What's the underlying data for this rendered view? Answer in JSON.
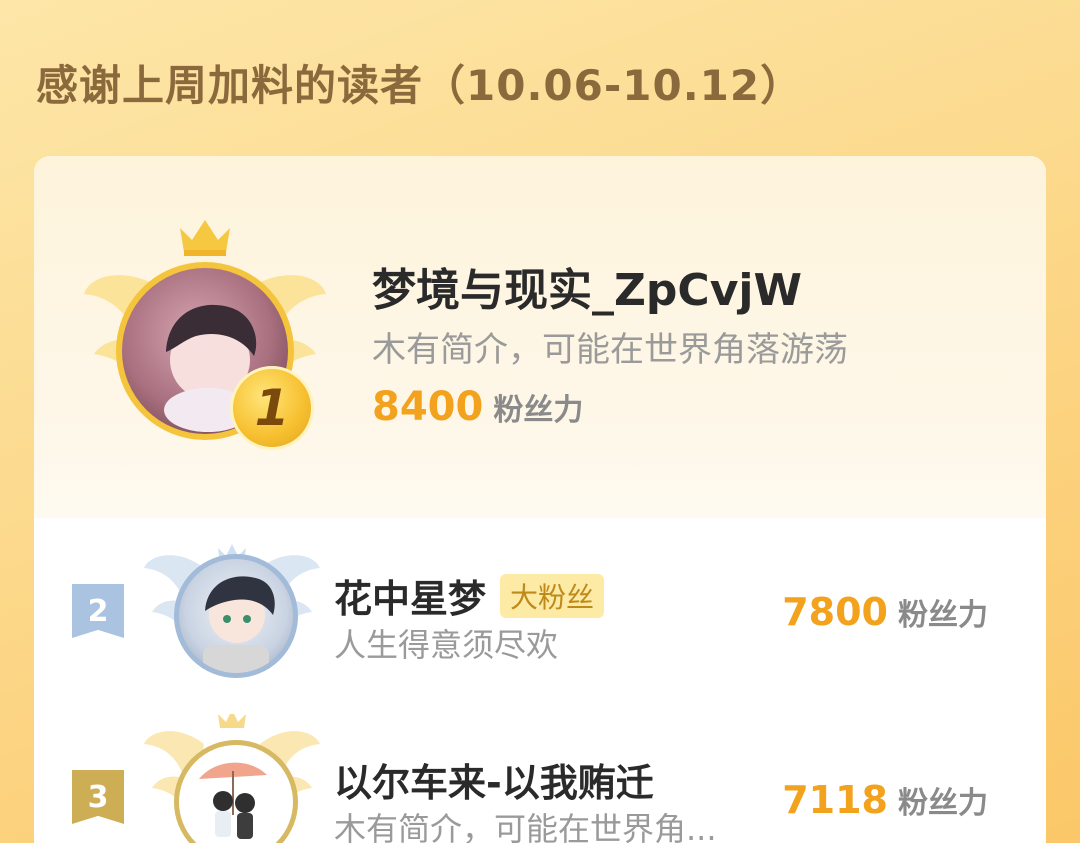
{
  "header": {
    "title": "感谢上周加料的读者（10.06-10.12）"
  },
  "fan_power_label": "粉丝力",
  "first": {
    "rank": "1",
    "name": "梦境与现实_ZpCvjW",
    "bio": "木有简介，可能在世界角落游荡",
    "score": "8400"
  },
  "others": [
    {
      "rank": "2",
      "name": "花中星梦",
      "badge": "大粉丝",
      "bio": "人生得意须尽欢",
      "score": "7800"
    },
    {
      "rank": "3",
      "name": "以尔车来-以我贿迁",
      "badge": "",
      "bio": "木有简介，可能在世界角...",
      "score": "7118"
    }
  ],
  "colors": {
    "accent": "#f2a21c",
    "gold": "#f7c233",
    "silver": "#9fb8d6",
    "bronze": "#c9a44a"
  }
}
